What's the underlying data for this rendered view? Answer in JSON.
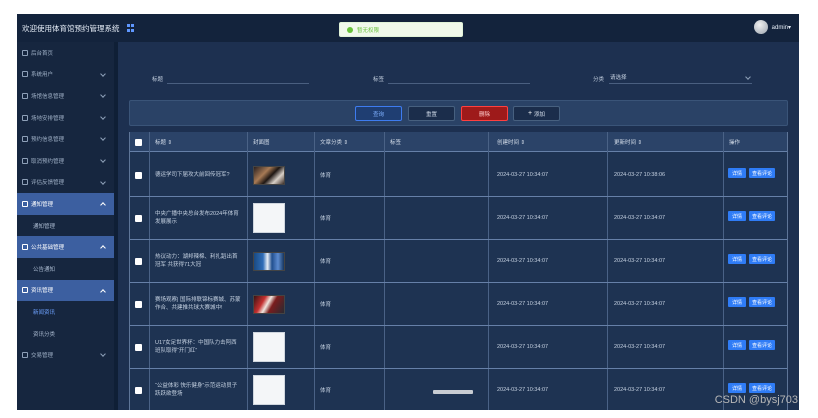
{
  "app": {
    "title": "欢迎使用体育馆预约管理系统",
    "user": "admin"
  },
  "toast": {
    "message": "暂无权限"
  },
  "sidebar": {
    "items": [
      {
        "label": "后台首页",
        "has_chevron": false
      },
      {
        "label": "系统用户",
        "has_chevron": true
      },
      {
        "label": "场馆信息管理",
        "has_chevron": true
      },
      {
        "label": "场地安排管理",
        "has_chevron": true
      },
      {
        "label": "预约信息管理",
        "has_chevron": true
      },
      {
        "label": "取消预约管理",
        "has_chevron": true
      },
      {
        "label": "评估反馈管理",
        "has_chevron": true
      },
      {
        "label": "通知管理",
        "active": true,
        "open": true,
        "children": [
          "通知管理"
        ]
      },
      {
        "label": "公共基础管理",
        "active": true,
        "open": true,
        "children": [
          "公告通知"
        ]
      },
      {
        "label": "资讯管理",
        "active": true,
        "open": true,
        "children": [
          "新闻资讯",
          "资讯分类"
        ],
        "current_child": "新闻资讯"
      },
      {
        "label": "交易管理",
        "has_chevron": true
      }
    ]
  },
  "filters": {
    "title_label": "标题",
    "tag_label": "标签",
    "category_label": "分类",
    "category_placeholder": "请选择"
  },
  "toolbar": {
    "search": "查询",
    "reset": "重置",
    "delete": "删除",
    "add": "添加"
  },
  "table": {
    "columns": [
      "标题 ⇕",
      "封面图",
      "文章分类 ⇕",
      "标签",
      "创建时间 ⇕",
      "更新时间 ⇕",
      "操作"
    ],
    "rows": [
      {
        "title": "德运学司下届攻大前回传冠军?",
        "thumb": "photo1",
        "category": "体育",
        "created": "2024-03-27 10:34:07",
        "updated": "2024-03-27 10:38:06"
      },
      {
        "title": "中央广播中央总台发布2024年体育发展展示",
        "thumb": "blank",
        "category": "体育",
        "created": "2024-03-27 10:34:07",
        "updated": "2024-03-27 10:34:07"
      },
      {
        "title": "热议动力：湖邦辣棉、利扎蹈出首冠军 共获得71大冠",
        "thumb": "photo2",
        "category": "体育",
        "created": "2024-03-27 10:34:07",
        "updated": "2024-03-27 10:34:07"
      },
      {
        "title": "赛场观察| 国际排联锦标赛城、苏蒙作合、共建推共球大赛城中!",
        "thumb": "photo3",
        "category": "体育",
        "created": "2024-03-27 10:34:07",
        "updated": "2024-03-27 10:34:07"
      },
      {
        "title": "U17女足世界杯：中国队力击阿西班队取得“开门红”",
        "thumb": "blank",
        "category": "体育",
        "created": "2024-03-27 10:34:07",
        "updated": "2024-03-27 10:34:07"
      },
      {
        "title": "“公益体彩 快乐健身”示范运动员子跃跃欲登场",
        "thumb": "blank",
        "category": "体育",
        "created": "2024-03-27 10:34:07",
        "updated": "2024-03-27 10:34:07"
      }
    ],
    "op_detail": "详情",
    "op_review": "查看评论"
  },
  "watermark": "CSDN @bysj703"
}
